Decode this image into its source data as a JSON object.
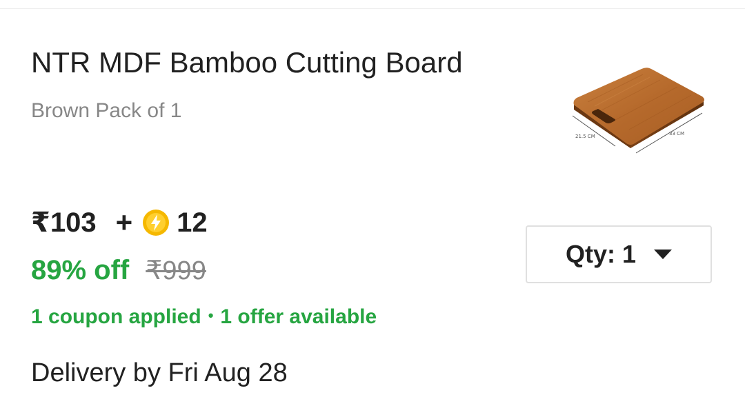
{
  "product": {
    "title": "NTR MDF Bamboo Cutting Board",
    "variant": "Brown Pack of 1",
    "image": {
      "icon": "cutting-board-image",
      "width_label": "21.5 CM",
      "length_label": "33 CM"
    }
  },
  "pricing": {
    "price": "₹103",
    "plus": "+",
    "coin_icon": "supercoin-icon",
    "coins": "12",
    "discount": "89% off",
    "original_price": "₹999"
  },
  "offers": {
    "coupon_text": "1 coupon applied",
    "separator": "•",
    "offer_text": "1 offer available"
  },
  "delivery": {
    "text": "Delivery by Fri Aug 28"
  },
  "quantity": {
    "label": "Qty:",
    "value": "1"
  },
  "colors": {
    "green": "#26a541",
    "grey_text": "#878787",
    "primary_text": "#212121",
    "coin_yellow": "#f5b800",
    "border": "#e0e0e0"
  }
}
